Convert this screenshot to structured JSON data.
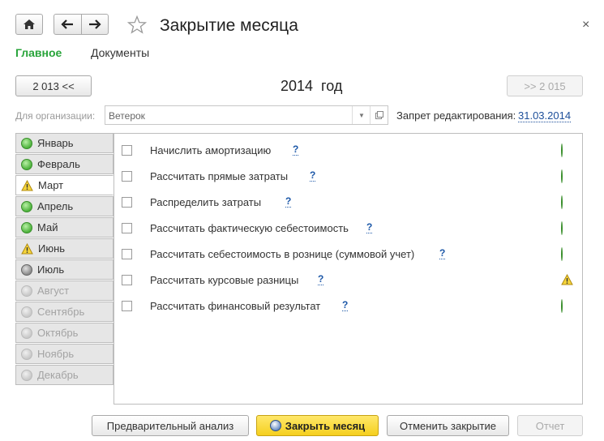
{
  "window": {
    "title": "Закрытие месяца",
    "close_glyph": "×"
  },
  "tabs": {
    "main": "Главное",
    "documents": "Документы"
  },
  "year_nav": {
    "prev_label": "2 013 <<",
    "year_label": "2014  год",
    "next_label": ">> 2 015"
  },
  "org": {
    "label": "Для организации:",
    "value": "Ветерок"
  },
  "lock": {
    "label": "Запрет редактирования:",
    "date": "31.03.2014"
  },
  "months": [
    {
      "label": "Январь",
      "status": "green"
    },
    {
      "label": "Февраль",
      "status": "green"
    },
    {
      "label": "Март",
      "status": "warning"
    },
    {
      "label": "Апрель",
      "status": "green"
    },
    {
      "label": "Май",
      "status": "green"
    },
    {
      "label": "Июнь",
      "status": "warning"
    },
    {
      "label": "Июль",
      "status": "grey"
    },
    {
      "label": "Август",
      "status": "disabled"
    },
    {
      "label": "Сентябрь",
      "status": "disabled"
    },
    {
      "label": "Октябрь",
      "status": "disabled"
    },
    {
      "label": "Ноябрь",
      "status": "disabled"
    },
    {
      "label": "Декабрь",
      "status": "disabled"
    }
  ],
  "selected_month": "Март",
  "tasks": [
    {
      "label": "Начислить амортизацию",
      "help": "?",
      "status": "green"
    },
    {
      "label": "Рассчитать прямые затраты",
      "help": "?",
      "status": "green"
    },
    {
      "label": "Распределить затраты",
      "help": "?",
      "status": "green"
    },
    {
      "label": "Рассчитать фактическую себестоимость",
      "help": "?",
      "status": "green"
    },
    {
      "label": "Рассчитать себестоимость в рознице (суммовой учет)",
      "help": "?",
      "status": "green"
    },
    {
      "label": "Рассчитать курсовые разницы",
      "help": "?",
      "status": "warning"
    },
    {
      "label": "Рассчитать финансовый результат",
      "help": "?",
      "status": "green"
    }
  ],
  "buttons": {
    "preliminary": "Предварительный анализ",
    "close_month": "Закрыть месяц",
    "cancel_close": "Отменить закрытие",
    "report": "Отчет"
  },
  "colors": {
    "accent_green": "#28a43a",
    "link_blue": "#1d58a8",
    "primary_yellow": "#f5cf1e"
  }
}
